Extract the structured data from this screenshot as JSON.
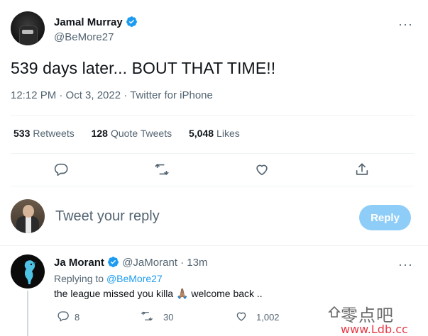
{
  "tweet": {
    "author_name": "Jamal Murray",
    "author_handle": "@BeMore27",
    "text": "539 days later... BOUT THAT TIME!!",
    "meta": "12:12 PM · Oct 3, 2022 · Twitter for iPhone",
    "stats": {
      "retweets_count": "533",
      "retweets_label": "Retweets",
      "quote_count": "128",
      "quote_label": "Quote Tweets",
      "likes_count": "5,048",
      "likes_label": "Likes"
    },
    "more_label": "···"
  },
  "compose": {
    "placeholder": "Tweet your reply",
    "reply_button": "Reply"
  },
  "reply": {
    "author_name": "Ja Morant",
    "author_handle": "@JaMorant",
    "time": "· 13m",
    "replying_prefix": "Replying to ",
    "replying_to": "@BeMore27",
    "text_before": "the league missed you killa ",
    "emoji": "🙏🏽",
    "text_after": " welcome back ..",
    "replies_count": "8",
    "retweets_count": "30",
    "likes_count": "1,002",
    "more_label": "···"
  },
  "watermark": {
    "cn": "零点吧",
    "url": "www.Ldb.cc"
  },
  "colors": {
    "accent": "#1d9bf0",
    "reply_button_disabled": "#8ecdf8",
    "secondary_text": "#536471",
    "divider": "#eff3f4"
  },
  "icons": [
    "verified-badge-icon",
    "more-icon",
    "reply-icon",
    "retweet-icon",
    "like-icon",
    "share-icon"
  ]
}
